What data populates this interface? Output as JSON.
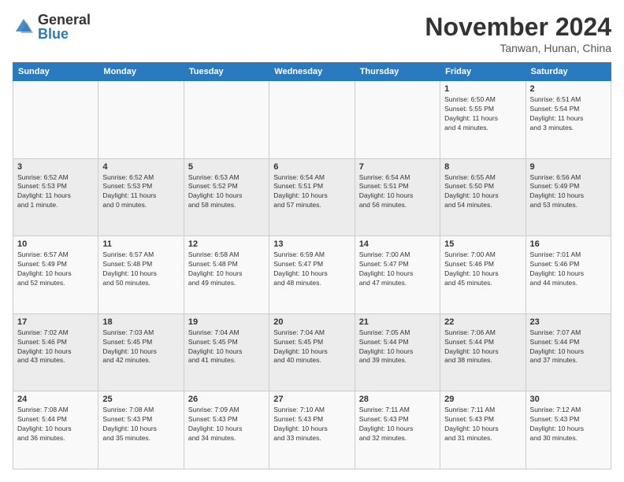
{
  "logo": {
    "general": "General",
    "blue": "Blue"
  },
  "header": {
    "month": "November 2024",
    "location": "Tanwan, Hunan, China"
  },
  "weekdays": [
    "Sunday",
    "Monday",
    "Tuesday",
    "Wednesday",
    "Thursday",
    "Friday",
    "Saturday"
  ],
  "weeks": [
    [
      {
        "day": "",
        "info": ""
      },
      {
        "day": "",
        "info": ""
      },
      {
        "day": "",
        "info": ""
      },
      {
        "day": "",
        "info": ""
      },
      {
        "day": "",
        "info": ""
      },
      {
        "day": "1",
        "info": "Sunrise: 6:50 AM\nSunset: 5:55 PM\nDaylight: 11 hours\nand 4 minutes."
      },
      {
        "day": "2",
        "info": "Sunrise: 6:51 AM\nSunset: 5:54 PM\nDaylight: 11 hours\nand 3 minutes."
      }
    ],
    [
      {
        "day": "3",
        "info": "Sunrise: 6:52 AM\nSunset: 5:53 PM\nDaylight: 11 hours\nand 1 minute."
      },
      {
        "day": "4",
        "info": "Sunrise: 6:52 AM\nSunset: 5:53 PM\nDaylight: 11 hours\nand 0 minutes."
      },
      {
        "day": "5",
        "info": "Sunrise: 6:53 AM\nSunset: 5:52 PM\nDaylight: 10 hours\nand 58 minutes."
      },
      {
        "day": "6",
        "info": "Sunrise: 6:54 AM\nSunset: 5:51 PM\nDaylight: 10 hours\nand 57 minutes."
      },
      {
        "day": "7",
        "info": "Sunrise: 6:54 AM\nSunset: 5:51 PM\nDaylight: 10 hours\nand 56 minutes."
      },
      {
        "day": "8",
        "info": "Sunrise: 6:55 AM\nSunset: 5:50 PM\nDaylight: 10 hours\nand 54 minutes."
      },
      {
        "day": "9",
        "info": "Sunrise: 6:56 AM\nSunset: 5:49 PM\nDaylight: 10 hours\nand 53 minutes."
      }
    ],
    [
      {
        "day": "10",
        "info": "Sunrise: 6:57 AM\nSunset: 5:49 PM\nDaylight: 10 hours\nand 52 minutes."
      },
      {
        "day": "11",
        "info": "Sunrise: 6:57 AM\nSunset: 5:48 PM\nDaylight: 10 hours\nand 50 minutes."
      },
      {
        "day": "12",
        "info": "Sunrise: 6:58 AM\nSunset: 5:48 PM\nDaylight: 10 hours\nand 49 minutes."
      },
      {
        "day": "13",
        "info": "Sunrise: 6:59 AM\nSunset: 5:47 PM\nDaylight: 10 hours\nand 48 minutes."
      },
      {
        "day": "14",
        "info": "Sunrise: 7:00 AM\nSunset: 5:47 PM\nDaylight: 10 hours\nand 47 minutes."
      },
      {
        "day": "15",
        "info": "Sunrise: 7:00 AM\nSunset: 5:46 PM\nDaylight: 10 hours\nand 45 minutes."
      },
      {
        "day": "16",
        "info": "Sunrise: 7:01 AM\nSunset: 5:46 PM\nDaylight: 10 hours\nand 44 minutes."
      }
    ],
    [
      {
        "day": "17",
        "info": "Sunrise: 7:02 AM\nSunset: 5:46 PM\nDaylight: 10 hours\nand 43 minutes."
      },
      {
        "day": "18",
        "info": "Sunrise: 7:03 AM\nSunset: 5:45 PM\nDaylight: 10 hours\nand 42 minutes."
      },
      {
        "day": "19",
        "info": "Sunrise: 7:04 AM\nSunset: 5:45 PM\nDaylight: 10 hours\nand 41 minutes."
      },
      {
        "day": "20",
        "info": "Sunrise: 7:04 AM\nSunset: 5:45 PM\nDaylight: 10 hours\nand 40 minutes."
      },
      {
        "day": "21",
        "info": "Sunrise: 7:05 AM\nSunset: 5:44 PM\nDaylight: 10 hours\nand 39 minutes."
      },
      {
        "day": "22",
        "info": "Sunrise: 7:06 AM\nSunset: 5:44 PM\nDaylight: 10 hours\nand 38 minutes."
      },
      {
        "day": "23",
        "info": "Sunrise: 7:07 AM\nSunset: 5:44 PM\nDaylight: 10 hours\nand 37 minutes."
      }
    ],
    [
      {
        "day": "24",
        "info": "Sunrise: 7:08 AM\nSunset: 5:44 PM\nDaylight: 10 hours\nand 36 minutes."
      },
      {
        "day": "25",
        "info": "Sunrise: 7:08 AM\nSunset: 5:43 PM\nDaylight: 10 hours\nand 35 minutes."
      },
      {
        "day": "26",
        "info": "Sunrise: 7:09 AM\nSunset: 5:43 PM\nDaylight: 10 hours\nand 34 minutes."
      },
      {
        "day": "27",
        "info": "Sunrise: 7:10 AM\nSunset: 5:43 PM\nDaylight: 10 hours\nand 33 minutes."
      },
      {
        "day": "28",
        "info": "Sunrise: 7:11 AM\nSunset: 5:43 PM\nDaylight: 10 hours\nand 32 minutes."
      },
      {
        "day": "29",
        "info": "Sunrise: 7:11 AM\nSunset: 5:43 PM\nDaylight: 10 hours\nand 31 minutes."
      },
      {
        "day": "30",
        "info": "Sunrise: 7:12 AM\nSunset: 5:43 PM\nDaylight: 10 hours\nand 30 minutes."
      }
    ]
  ]
}
